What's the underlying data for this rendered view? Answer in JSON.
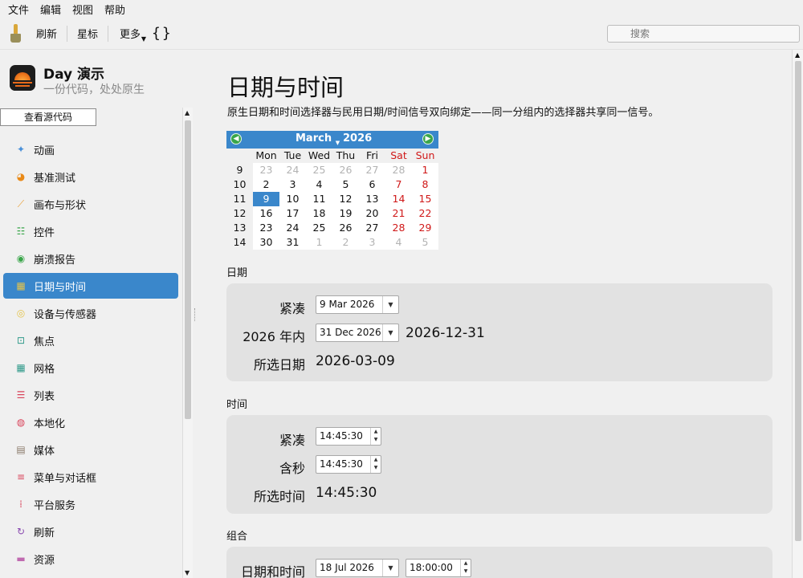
{
  "menu": [
    "文件",
    "编辑",
    "视图",
    "帮助"
  ],
  "toolbar": {
    "refresh": "刷新",
    "star": "星标",
    "more": "更多",
    "braces": "{}",
    "search_placeholder": "搜索"
  },
  "app": {
    "title": "Day 演示",
    "subtitle": "一份代码，处处原生",
    "source_button": "查看源代码"
  },
  "sidebar": {
    "items": [
      {
        "label": "动画",
        "icon": "sparkles-icon",
        "color": "#4a90d9"
      },
      {
        "label": "基准测试",
        "icon": "speedometer-icon",
        "color": "#e98a18"
      },
      {
        "label": "画布与形状",
        "icon": "brush-icon",
        "color": "#e9a036"
      },
      {
        "label": "控件",
        "icon": "sliders-icon",
        "color": "#3aa64a"
      },
      {
        "label": "崩溃报告",
        "icon": "broadcast-icon",
        "color": "#3aa64a"
      },
      {
        "label": "日期与时间",
        "icon": "calendar-icon",
        "color": "#e4c34a",
        "active": true
      },
      {
        "label": "设备与传感器",
        "icon": "sensor-icon",
        "color": "#e4c34a"
      },
      {
        "label": "焦点",
        "icon": "focus-icon",
        "color": "#2f9a8a"
      },
      {
        "label": "网格",
        "icon": "grid-icon",
        "color": "#2f9a8a"
      },
      {
        "label": "列表",
        "icon": "list-icon",
        "color": "#d9435a"
      },
      {
        "label": "本地化",
        "icon": "globe-icon",
        "color": "#d9435a"
      },
      {
        "label": "媒体",
        "icon": "film-icon",
        "color": "#8a7a6a"
      },
      {
        "label": "菜单与对话框",
        "icon": "menu-icon",
        "color": "#d9435a"
      },
      {
        "label": "平台服务",
        "icon": "dots-grid-icon",
        "color": "#d9435a"
      },
      {
        "label": "刷新",
        "icon": "refresh-icon",
        "color": "#8a4ab0"
      },
      {
        "label": "资源",
        "icon": "folder-icon",
        "color": "#c06ab0"
      }
    ]
  },
  "page": {
    "title": "日期与时间",
    "description": "原生日期和时间选择器与民用日期/时间信号双向绑定——同一分组内的选择器共享同一信号。"
  },
  "calendar": {
    "month": "March",
    "year": "2026",
    "weekday_headers": [
      "Mon",
      "Tue",
      "Wed",
      "Thu",
      "Fri",
      "Sat",
      "Sun"
    ],
    "weeks": [
      {
        "week": "9",
        "days": [
          "23",
          "24",
          "25",
          "26",
          "27",
          "28",
          "1"
        ],
        "out": [
          true,
          true,
          true,
          true,
          true,
          true,
          false
        ]
      },
      {
        "week": "10",
        "days": [
          "2",
          "3",
          "4",
          "5",
          "6",
          "7",
          "8"
        ],
        "out": [
          false,
          false,
          false,
          false,
          false,
          false,
          false
        ]
      },
      {
        "week": "11",
        "days": [
          "9",
          "10",
          "11",
          "12",
          "13",
          "14",
          "15"
        ],
        "out": [
          false,
          false,
          false,
          false,
          false,
          false,
          false
        ]
      },
      {
        "week": "12",
        "days": [
          "16",
          "17",
          "18",
          "19",
          "20",
          "21",
          "22"
        ],
        "out": [
          false,
          false,
          false,
          false,
          false,
          false,
          false
        ]
      },
      {
        "week": "13",
        "days": [
          "23",
          "24",
          "25",
          "26",
          "27",
          "28",
          "29"
        ],
        "out": [
          false,
          false,
          false,
          false,
          false,
          false,
          false
        ]
      },
      {
        "week": "14",
        "days": [
          "30",
          "31",
          "1",
          "2",
          "3",
          "4",
          "5"
        ],
        "out": [
          false,
          false,
          true,
          true,
          true,
          true,
          true
        ]
      }
    ],
    "selected_day": "9",
    "accent_color": "#3a87cb",
    "weekend_color": "#d01818"
  },
  "date_section": {
    "label": "日期",
    "compact_label": "紧凑",
    "compact_value": "9 Mar 2026",
    "in_year_label": "2026 年内",
    "in_year_value": "31 Dec 2026",
    "in_year_readout": "2026-12-31",
    "selected_label": "所选日期",
    "selected_value": "2026-03-09"
  },
  "time_section": {
    "label": "时间",
    "compact_label": "紧凑",
    "compact_value": "14:45:30",
    "seconds_label": "含秒",
    "seconds_value": "14:45:30",
    "selected_label": "所选时间",
    "selected_value": "14:45:30"
  },
  "combo_section": {
    "label": "组合",
    "datetime_label": "日期和时间",
    "date_value": "18 Jul 2026",
    "time_value": "18:00:00"
  }
}
